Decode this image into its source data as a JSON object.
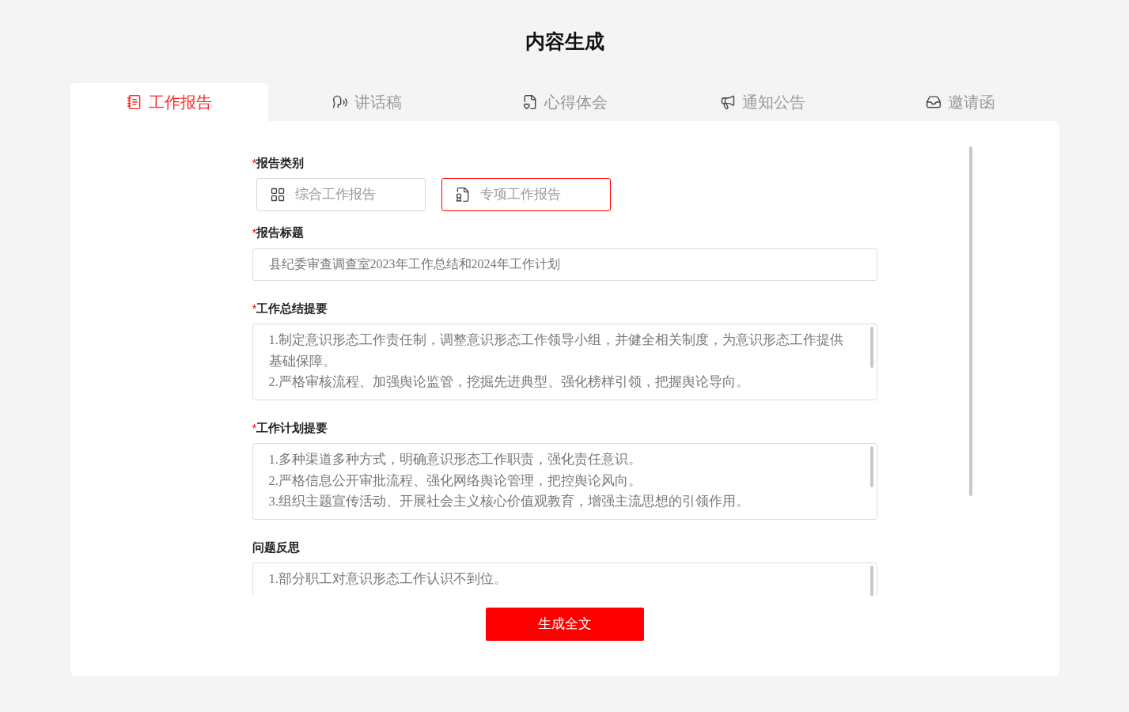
{
  "title": "内容生成",
  "tabs": [
    {
      "label": "工作报告",
      "selected": true
    },
    {
      "label": "讲话稿",
      "selected": false
    },
    {
      "label": "心得体会",
      "selected": false
    },
    {
      "label": "通知公告",
      "selected": false
    },
    {
      "label": "邀请函",
      "selected": false
    }
  ],
  "fields": [
    {
      "kind": "choice",
      "label": "报告类别",
      "mark": "*",
      "options": [
        {
          "label": "综合工作报告",
          "selected": false
        },
        {
          "label": "专项工作报告",
          "selected": true
        }
      ]
    },
    {
      "kind": "input",
      "label": "报告标题",
      "mark": "*",
      "value": "县纪委审查调查室2023年工作总结和2024年工作计划"
    },
    {
      "kind": "textarea",
      "label": "工作总结提要",
      "mark": "*",
      "lines": [
        "1.制定意识形态工作责任制，调整意识形态工作领导小组，并健全相关制度，为意识形态工作提供基础保障。",
        "2.严格审核流程、加强舆论监管，挖掘先进典型、强化榜样引领，把握舆论导向。"
      ]
    },
    {
      "kind": "textarea",
      "label": "工作计划提要",
      "mark": "*",
      "lines": [
        "1.多种渠道多种方式，明确意识形态工作职责，强化责任意识。",
        "2.严格信息公开审批流程、强化网络舆论管理，把控舆论风向。",
        "3.组织主题宣传活动、开展社会主义核心价值观教育，增强主流思想的引领作用。"
      ]
    },
    {
      "kind": "textarea",
      "label": "问题反思",
      "lines": [
        "1.部分职工对意识形态工作认识不到位。"
      ]
    }
  ],
  "submit": "生成全文"
}
